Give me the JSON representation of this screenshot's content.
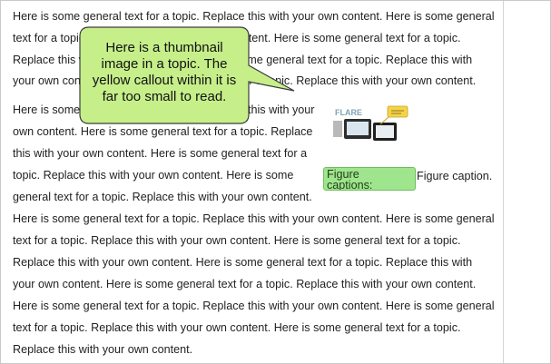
{
  "document": {
    "lines": [
      "Here is some general text for a topic. Replace this with your own content. Here is some general",
      "text for a topic. Replace this with your own content. Here is some general text for a topic.",
      "Replace this with your own content. Here is some general text for a topic. Replace this with",
      "your own content. Here is some general text for a topic. Replace this with your own content.",
      "Here is some general text for a topic. Replace this with your",
      "own content. Here is some general text for a topic. Replace",
      "this with your own content. Here is some general text for a",
      "topic. Replace this with your own content. Here is some",
      "general text for a topic. Replace this with your own content.",
      "Here is some general text for a topic. Replace this with your own content. Here is some general",
      "text for a topic. Replace this with your own content. Here is some general text for a topic.",
      "Replace this with your own content. Here is some general text for a topic. Replace this with",
      "your own content. Here is some general text for a topic. Replace this with your own content.",
      "Here is some general text for a topic. Replace this with your own content. Here is some general",
      "text for a topic. Replace this with your own content. Here is some general text for a topic.",
      "Replace this with your own content."
    ]
  },
  "figure": {
    "caption_box_text": "Figure captions: Capt",
    "caption_text": "Figure caption.",
    "thumbnail_logo_text": "FLARE"
  },
  "callout": {
    "lines": [
      "Here is a thumbnail",
      "image in a topic. The",
      "yellow callout within it is",
      "far too small to read."
    ],
    "fill_color": "#c6ef8a",
    "border_color": "#3c3c3c"
  }
}
